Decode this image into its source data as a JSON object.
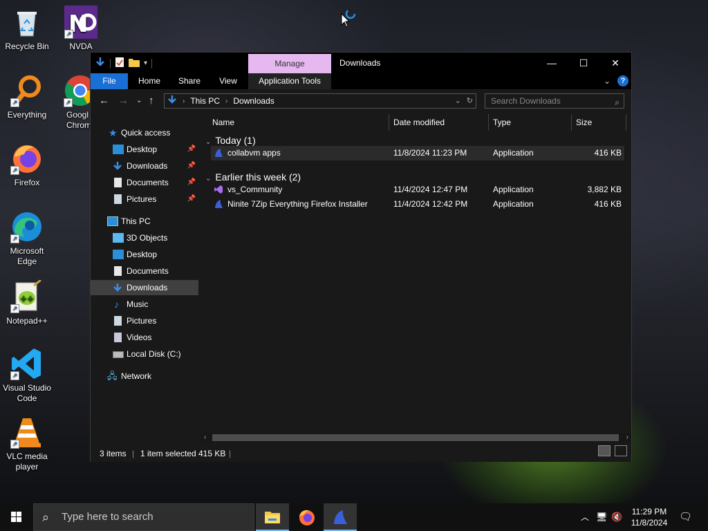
{
  "desktop": {
    "icons": [
      {
        "label": "Recycle Bin",
        "icon": "recycle-bin-icon"
      },
      {
        "label": "NVDA",
        "icon": "nvda-icon"
      },
      {
        "label": "Everything",
        "icon": "everything-icon"
      },
      {
        "label": "Googl Chrom",
        "icon": "chrome-icon"
      },
      {
        "label": "Firefox",
        "icon": "firefox-icon"
      },
      {
        "label": "Microsoft Edge",
        "icon": "edge-icon"
      },
      {
        "label": "Notepad++",
        "icon": "notepadpp-icon"
      },
      {
        "label": "Visual Studio Code",
        "icon": "vscode-icon"
      },
      {
        "label": "VLC media player",
        "icon": "vlc-icon"
      }
    ]
  },
  "window": {
    "title": "Downloads",
    "manage_tab": "Manage",
    "controls": {
      "minimize": "—",
      "maximize": "☐",
      "close": "✕"
    },
    "ribbon_tabs": {
      "file": "File",
      "home": "Home",
      "share": "Share",
      "view": "View",
      "app_tools": "Application Tools"
    },
    "help": "?",
    "address": {
      "part1": "This PC",
      "part2": "Downloads"
    },
    "search_placeholder": "Search Downloads"
  },
  "nav_pane": {
    "quick_access": "Quick access",
    "qa_items": [
      "Desktop",
      "Downloads",
      "Documents",
      "Pictures"
    ],
    "this_pc": "This PC",
    "pc_items": [
      "3D Objects",
      "Desktop",
      "Documents",
      "Downloads",
      "Music",
      "Pictures",
      "Videos",
      "Local Disk (C:)"
    ],
    "network": "Network"
  },
  "columns": {
    "name": "Name",
    "date": "Date modified",
    "type": "Type",
    "size": "Size"
  },
  "groups": [
    {
      "label": "Today (1)",
      "files": [
        {
          "name": "collabvm apps",
          "date": "11/8/2024 11:23 PM",
          "type": "Application",
          "size": "416 KB"
        }
      ]
    },
    {
      "label": "Earlier this week (2)",
      "files": [
        {
          "name": "vs_Community",
          "date": "11/4/2024 12:47 PM",
          "type": "Application",
          "size": "3,882 KB"
        },
        {
          "name": "Ninite 7Zip Everything Firefox Installer",
          "date": "11/4/2024 12:42 PM",
          "type": "Application",
          "size": "416 KB"
        }
      ]
    }
  ],
  "status": {
    "items": "3 items",
    "selected": "1 item selected",
    "size": "415 KB"
  },
  "taskbar": {
    "search_placeholder": "Type here to search",
    "time": "11:29 PM",
    "date": "11/8/2024"
  }
}
